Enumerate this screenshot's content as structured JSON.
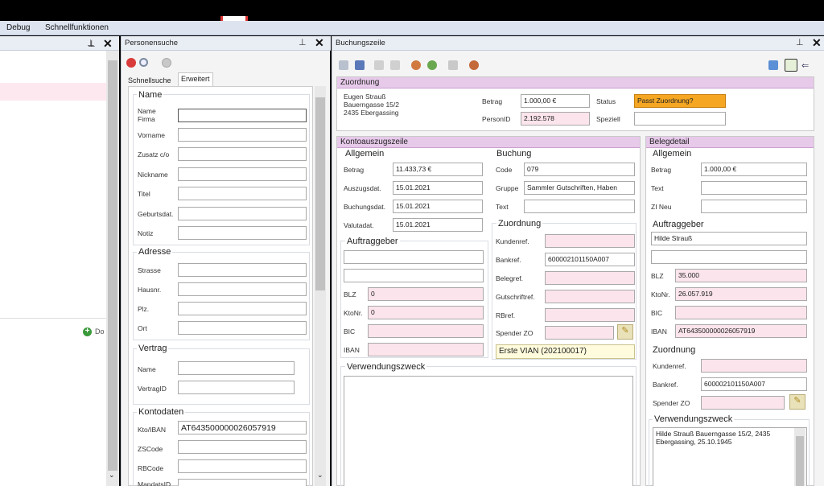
{
  "menu": {
    "debug": "Debug",
    "schnellfunktionen": "Schnellfunktionen"
  },
  "left_panel": {
    "add_label": "Do"
  },
  "personensuche": {
    "title": "Personensuche",
    "tabs": [
      "Schnellsuche",
      "Erweitert"
    ],
    "groups": {
      "name": "Name",
      "adresse": "Adresse",
      "vertrag": "Vertrag",
      "kontodaten": "Kontodaten"
    },
    "fields": {
      "name_firma_1": "Name",
      "name_firma_2": "Firma",
      "vorname": "Vorname",
      "zusatz": "Zusatz c/o",
      "nickname": "Nickname",
      "titel": "Titel",
      "geburtsdat": "Geburtsdat.",
      "notiz": "Notiz",
      "strasse": "Strasse",
      "hausnr": "Hausnr.",
      "plz": "Plz.",
      "ort": "Ort",
      "vertrag_name": "Name",
      "vertragid": "VertragID",
      "kto_iban": "Kto/IBAN",
      "zscode": "ZSCode",
      "rbcode": "RBCode",
      "mandatsid": "MandatsID"
    },
    "values": {
      "kto_iban": "AT643500000026057919"
    }
  },
  "buchungszeile": {
    "title": "Buchungszeile",
    "zuordnung": {
      "header": "Zuordnung",
      "address": [
        "Eugen Strauß",
        "Bauerngasse 15/2",
        "2435 Ebergassing"
      ],
      "betrag_label": "Betrag",
      "betrag": "1.000,00 €",
      "status_label": "Status",
      "status": "Passt Zuordnung?",
      "personid_label": "PersonID",
      "personid": "2.192.578",
      "speziell_label": "Speziell",
      "speziell": ""
    },
    "kontoauszugszeile": {
      "header": "Kontoauszugszeile",
      "allgemein": "Allgemein",
      "betrag_label": "Betrag",
      "betrag": "11.433,73 €",
      "auszugsdat_label": "Auszugsdat.",
      "auszugsdat": "15.01.2021",
      "buchungsdat_label": "Buchungsdat.",
      "buchungsdat": "15.01.2021",
      "valutadat_label": "Valutadat.",
      "valutadat": "15.01.2021",
      "auftraggeber": "Auftraggeber",
      "blz_label": "BLZ",
      "blz": "0",
      "ktonr_label": "KtoNr.",
      "ktonr": "0",
      "bic_label": "BIC",
      "iban_label": "IBAN",
      "verwendungszweck": "Verwendungszweck",
      "buchung": "Buchung",
      "code_label": "Code",
      "code": "079",
      "gruppe_label": "Gruppe",
      "gruppe": "Sammler Gutschriften, Haben",
      "text_label": "Text",
      "zuordnung": "Zuordnung",
      "kundenref_label": "Kundenref.",
      "bankref_label": "Bankref.",
      "bankref": "600002101150A007",
      "belegref_label": "Belegref.",
      "gutschriftref_label": "Gutschriftref.",
      "rbref_label": "RBref.",
      "spender_label": "Spender ZO",
      "erste_vian": "Erste VIAN (202100017)"
    },
    "belegdetail": {
      "header": "Belegdetail",
      "allgemein": "Allgemein",
      "betrag_label": "Betrag",
      "betrag": "1.000,00 €",
      "text_label": "Text",
      "zi_neu_label": "ZI Neu",
      "auftraggeber": "Auftraggeber",
      "auftraggeber_name": "Hilde Strauß",
      "blz_label": "BLZ",
      "blz": "35.000",
      "ktonr_label": "KtoNr.",
      "ktonr": "26.057.919",
      "bic_label": "BIC",
      "iban_label": "IBAN",
      "iban": "AT643500000026057919",
      "zuordnung": "Zuordnung",
      "kundenref_label": "Kundenref.",
      "bankref_label": "Bankref.",
      "bankref": "600002101150A007",
      "spender_label": "Spender ZO",
      "verwendungszweck": "Verwendungszweck",
      "verwendungszweck_text": [
        "Hilde Strauß Bauerngasse 15/2, 2435",
        "Ebergassing, 25.10.1945"
      ]
    }
  },
  "colors": {
    "section_header": "#e7c9ea",
    "pink_field": "#fbe4ec",
    "status_orange": "#f5a623"
  }
}
